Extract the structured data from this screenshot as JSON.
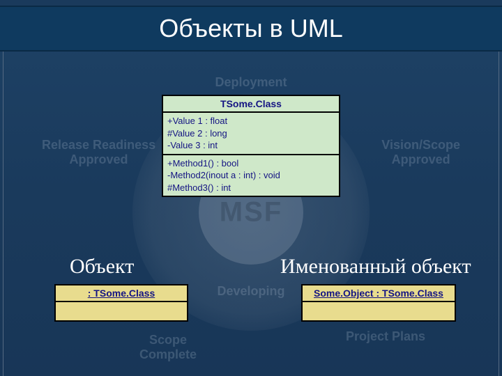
{
  "title": "Объекты в UML",
  "watermarks": {
    "deployment": "Deployment",
    "release": "Release Readiness\nApproved",
    "vision": "Vision/Scope\nApproved",
    "developing": "Developing",
    "scope": "Scope\nComplete",
    "project": "Project Plans",
    "msf": "MSF"
  },
  "uml_class": {
    "name": "TSome.Class",
    "attributes": [
      "+Value 1 : float",
      "#Value 2 : long",
      "-Value 3 : int"
    ],
    "operations": [
      "+Method1() : bool",
      "-Method2(inout a : int) : void",
      "#Method3() : int"
    ]
  },
  "labels": {
    "object": "Объект",
    "named_object": "Именованный объект"
  },
  "uml_objects": {
    "anonymous": " : TSome.Class",
    "named": "Some.Object : TSome.Class"
  }
}
